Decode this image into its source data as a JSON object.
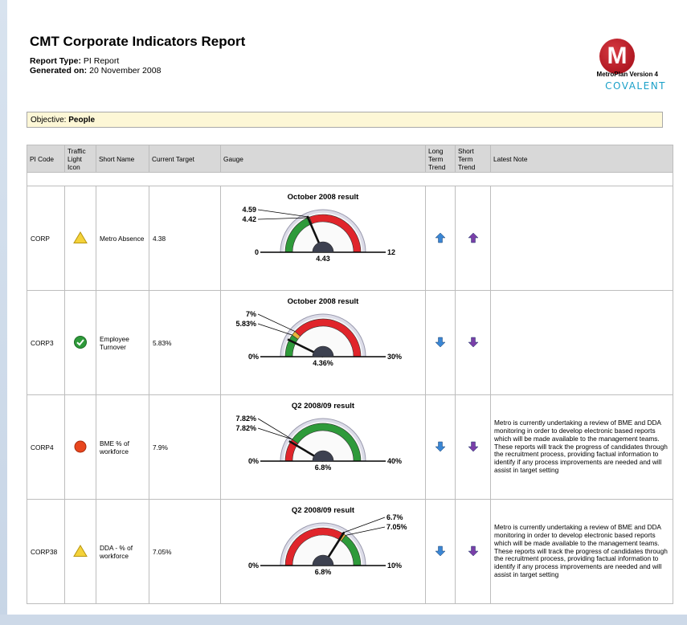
{
  "report": {
    "title": "CMT Corporate Indicators Report",
    "type_label": "Report Type:",
    "type_value": "PI Report",
    "generated_label": "Generated on:",
    "generated_value": "20 November 2008"
  },
  "logo": {
    "letter": "M",
    "version": "MetroPlan Version 4",
    "brand": "COVALENT",
    "brand_color": "#1aa0c8"
  },
  "objective": {
    "label": "Objective:",
    "value": "People"
  },
  "columns": [
    "PI Code",
    "Traffic Light Icon",
    "Short Name",
    "Current Target",
    "Gauge",
    "Long Term Trend",
    "Short Term Trend",
    "Latest Note"
  ],
  "rows": [
    {
      "code": "CORP",
      "traffic_light": "amber-triangle-icon",
      "short_name": "Metro Absence",
      "current_target": "4.38",
      "gauge": {
        "title": "October 2008 result",
        "min": 0,
        "max": 12,
        "min_label": "0",
        "max_label": "12",
        "value": 4.43,
        "value_label": "4.43",
        "bands": [
          {
            "from": 0,
            "to": 4.42,
            "color": "green"
          },
          {
            "from": 4.42,
            "to": 4.59,
            "color": "amber"
          },
          {
            "from": 4.59,
            "to": 12,
            "color": "red"
          }
        ],
        "markers": [
          {
            "value": 4.59,
            "label": "4.59"
          },
          {
            "value": 4.42,
            "label": "4.42"
          }
        ],
        "marker_side": "left"
      },
      "long_trend": "up",
      "short_trend": "up",
      "note": ""
    },
    {
      "code": "CORP3",
      "traffic_light": "green-check-icon",
      "short_name": "Employee Turnover",
      "current_target": "5.83%",
      "gauge": {
        "title": "October 2008 result",
        "min": 0,
        "max": 30,
        "min_label": "0%",
        "max_label": "30%",
        "value": 4.36,
        "value_label": "4.36%",
        "bands": [
          {
            "from": 0,
            "to": 5.83,
            "color": "green"
          },
          {
            "from": 5.83,
            "to": 7,
            "color": "amber"
          },
          {
            "from": 7,
            "to": 30,
            "color": "red"
          }
        ],
        "markers": [
          {
            "value": 7,
            "label": "7%"
          },
          {
            "value": 5.83,
            "label": "5.83%"
          }
        ],
        "marker_side": "left"
      },
      "long_trend": "down",
      "short_trend": "down",
      "note": ""
    },
    {
      "code": "CORP4",
      "traffic_light": "red-circle-icon",
      "short_name": "BME % of workforce",
      "current_target": "7.9%",
      "gauge": {
        "title": "Q2 2008/09 result",
        "min": 0,
        "max": 40,
        "min_label": "0%",
        "max_label": "40%",
        "value": 6.8,
        "value_label": "6.8%",
        "bands": [
          {
            "from": 0,
            "to": 7.82,
            "color": "red"
          },
          {
            "from": 7.82,
            "to": 40,
            "color": "green"
          }
        ],
        "markers": [
          {
            "value": 7.82,
            "label": "7.82%"
          },
          {
            "value": 7.82,
            "label": "7.82%"
          }
        ],
        "marker_side": "left"
      },
      "long_trend": "down",
      "short_trend": "down",
      "note": "Metro is currently undertaking a review of BME and DDA monitoring in order to develop electronic based reports which will be made available to the management teams. These reports will track the progress of candidates through the recruitment process, providing factual information to identify if any process improvements are needed and will assist in target setting"
    },
    {
      "code": "CORP38",
      "traffic_light": "amber-triangle-icon",
      "short_name": "DDA - % of workforce",
      "current_target": "7.05%",
      "gauge": {
        "title": "Q2 2008/09 result",
        "min": 0,
        "max": 10,
        "min_label": "0%",
        "max_label": "10%",
        "value": 6.8,
        "value_label": "6.8%",
        "bands": [
          {
            "from": 0,
            "to": 6.7,
            "color": "red"
          },
          {
            "from": 6.7,
            "to": 7.05,
            "color": "amber"
          },
          {
            "from": 7.05,
            "to": 10,
            "color": "green"
          }
        ],
        "markers": [
          {
            "value": 6.7,
            "label": "6.7%"
          },
          {
            "value": 7.05,
            "label": "7.05%"
          }
        ],
        "marker_side": "right"
      },
      "long_trend": "down",
      "short_trend": "down",
      "note": "Metro is currently undertaking a review of BME and DDA monitoring in order to develop electronic based reports which will be made available to the management teams. These reports will track the progress of candidates through the recruitment process, providing factual information to identify if any process improvements are needed and will assist in target setting"
    }
  ],
  "colors": {
    "green": "#2e9a3a",
    "amber": "#e8b63a",
    "red": "#e0252b",
    "long_trend": "#3a86d4",
    "short_trend": "#7a3fa8",
    "header_bg": "#d8d8d8",
    "objective_bg": "#fdf7d6"
  }
}
